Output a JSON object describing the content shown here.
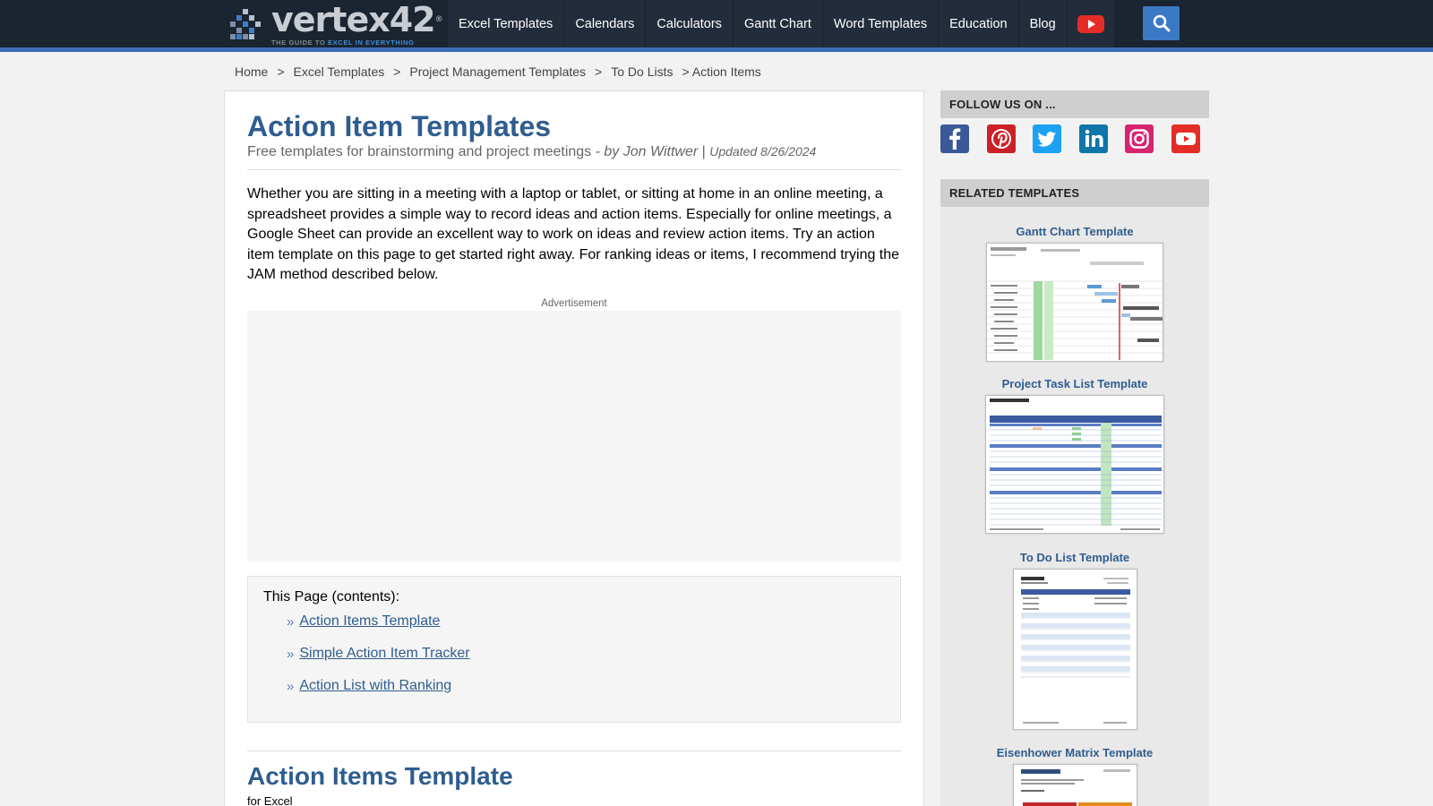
{
  "header": {
    "logo": {
      "word": "vertex42",
      "reg": "®",
      "tag_prefix": "THE GUIDE TO ",
      "tag_accent": "EXCEL IN EVERYTHING"
    },
    "nav": [
      {
        "label": "Excel Templates"
      },
      {
        "label": "Calendars"
      },
      {
        "label": "Calculators"
      },
      {
        "label": "Gantt Chart"
      },
      {
        "label": "Word Templates"
      },
      {
        "label": "Education"
      },
      {
        "label": "Blog"
      }
    ],
    "youtube_icon": "youtube-icon",
    "search_icon": "search-icon"
  },
  "breadcrumb": {
    "items": [
      "Home",
      "Excel Templates",
      "Project Management Templates",
      "To Do Lists"
    ],
    "separator": ">",
    "current": "> Action Items"
  },
  "main": {
    "title": "Action Item Templates",
    "subtitle": "Free templates for brainstorming and project meetings",
    "byline": " - by Jon Wittwer",
    "pipe": " | ",
    "updated": "Updated 8/26/2024",
    "intro": "Whether you are sitting in a meeting with a laptop or tablet, or sitting at home in an online meeting, a spreadsheet provides a simple way to record ideas and action items. Especially for online meetings, a Google Sheet can provide an excellent way to work on ideas and review action items. Try an action item template on this page to get started right away. For ranking ideas or items, I recommend trying the JAM method described below.",
    "ad_label": "Advertisement",
    "toc": {
      "title": "This Page (contents):",
      "bullet": "»",
      "items": [
        "Action Items Template",
        "Simple Action Item Tracker",
        "Action List with Ranking"
      ]
    },
    "section": {
      "title": "Action Items Template",
      "subtitle": "for Excel"
    }
  },
  "sidebar": {
    "follow_heading": "FOLLOW US ON ...",
    "social": [
      {
        "icon": "facebook-icon",
        "color": "#3b5998"
      },
      {
        "icon": "pinterest-icon",
        "color": "#cb2027"
      },
      {
        "icon": "twitter-icon",
        "color": "#1da1f2"
      },
      {
        "icon": "linkedin-icon",
        "color": "#0e76a8"
      },
      {
        "icon": "instagram-icon",
        "color": "#d6246e"
      },
      {
        "icon": "youtube-icon",
        "color": "#e52d27"
      }
    ],
    "related_heading": "RELATED TEMPLATES",
    "related": [
      {
        "title": "Gantt Chart Template"
      },
      {
        "title": "Project Task List Template"
      },
      {
        "title": "To Do List Template"
      },
      {
        "title": "Eisenhower Matrix Template"
      }
    ]
  }
}
